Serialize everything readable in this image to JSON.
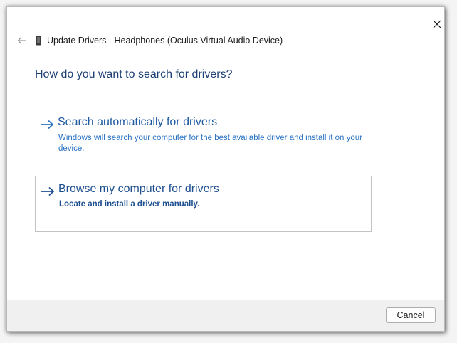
{
  "window": {
    "title": "Update Drivers - Headphones (Oculus Virtual Audio Device)",
    "title_icon": "headphones-device-icon"
  },
  "controls": {
    "close_icon": "close-icon",
    "back_icon": "back-arrow-icon"
  },
  "main": {
    "heading": "How do you want to search for drivers?",
    "options": [
      {
        "title": "Search automatically for drivers",
        "description": "Windows will search your computer for the best available driver and install it on your device.",
        "icon": "arrow-right-icon"
      },
      {
        "title": "Browse my computer for drivers",
        "description": "Locate and install a driver manually.",
        "icon": "arrow-right-icon"
      }
    ]
  },
  "footer": {
    "cancel_label": "Cancel"
  },
  "colors": {
    "heading": "#1e3f73",
    "link": "#1e5aa0",
    "link_desc": "#2a73c4",
    "arrow": "#2a73c4"
  }
}
